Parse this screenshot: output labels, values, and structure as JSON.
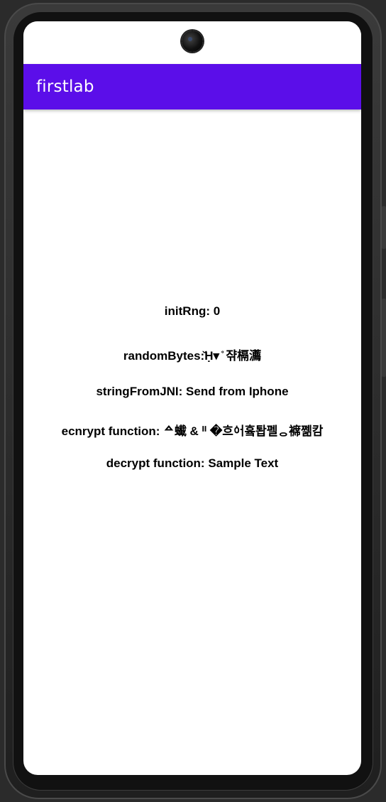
{
  "app": {
    "title": "firstlab"
  },
  "output": {
    "init_rng": "initRng: 0",
    "random_bytes": "randomBytes:̌Ḥ▾ ̊ 쟊槅瀳",
    "string_from_jni": "stringFromJNI: Send from Iphone",
    "encrypt": "ecnrypt function: ᅀ蠘 & ᐦ �흐ᅌᅥ흌퇍펠ᆼ褯쩲캄",
    "decrypt": "decrypt function: Sample Text"
  },
  "colors": {
    "app_bar": "#5b0ee9",
    "app_title": "#ffffff",
    "screen_bg": "#ffffff",
    "text": "#000000"
  },
  "icons": {
    "camera": "front-camera-icon"
  }
}
